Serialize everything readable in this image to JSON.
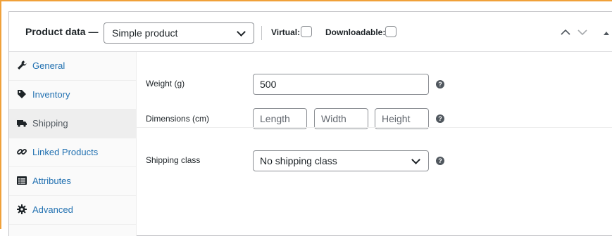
{
  "header": {
    "title": "Product data —",
    "product_type": "Simple product",
    "virtual_label": "Virtual:",
    "downloadable_label": "Downloadable:"
  },
  "sidebar": {
    "items": [
      {
        "label": "General",
        "icon": "wrench-icon",
        "active": false
      },
      {
        "label": "Inventory",
        "icon": "tag-icon",
        "active": false
      },
      {
        "label": "Shipping",
        "icon": "truck-icon",
        "active": true
      },
      {
        "label": "Linked Products",
        "icon": "link-icon",
        "active": false
      },
      {
        "label": "Attributes",
        "icon": "list-view-icon",
        "active": false
      },
      {
        "label": "Advanced",
        "icon": "gear-icon",
        "active": false
      }
    ]
  },
  "shipping": {
    "weight_label": "Weight (g)",
    "weight_value": "500",
    "dimensions_label": "Dimensions (cm)",
    "length_placeholder": "Length",
    "width_placeholder": "Width",
    "height_placeholder": "Height",
    "shipping_class_label": "Shipping class",
    "shipping_class_value": "No shipping class"
  },
  "colors": {
    "accent_border": "#f0a13a",
    "link": "#2271b1",
    "active_tab_bg": "#eeeeee"
  }
}
